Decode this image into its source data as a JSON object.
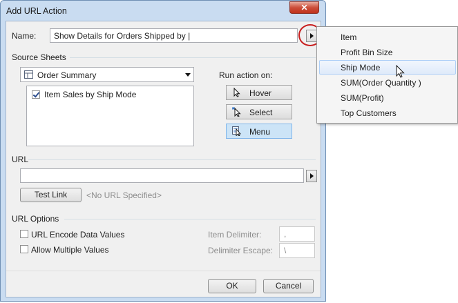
{
  "dialog": {
    "title": "Add URL Action",
    "close_label": "✕",
    "name_label": "Name:",
    "name_value": "Show Details for Orders Shipped by |",
    "source_sheets_label": "Source Sheets",
    "sheet_dropdown_value": "Order Summary",
    "sheets": [
      {
        "label": "Item Sales by Ship Mode",
        "checked": true
      }
    ],
    "run_action_label": "Run action on:",
    "run_actions": {
      "hover": "Hover",
      "select": "Select",
      "menu": "Menu",
      "active": "Menu"
    },
    "url_label": "URL",
    "url_value": "",
    "test_link_label": "Test Link",
    "no_url_text": "<No URL Specified>",
    "url_options_label": "URL Options",
    "encode_label": "URL Encode Data Values",
    "encode_checked": false,
    "multiple_label": "Allow Multiple Values",
    "multiple_checked": false,
    "item_delimiter_label": "Item Delimiter:",
    "item_delimiter_value": ",",
    "delimiter_escape_label": "Delimiter Escape:",
    "delimiter_escape_value": "\\",
    "ok_label": "OK",
    "cancel_label": "Cancel"
  },
  "field_menu": {
    "items": [
      "Item",
      "Profit Bin Size",
      "Ship Mode",
      "SUM(Order Quantity )",
      "SUM(Profit)",
      "Top Customers"
    ],
    "highlighted": "Ship Mode"
  },
  "colors": {
    "frame": "#c9dcf1",
    "highlight": "#cce4f7",
    "annotation_ring": "#c81e1e",
    "close": "#c0321c"
  }
}
